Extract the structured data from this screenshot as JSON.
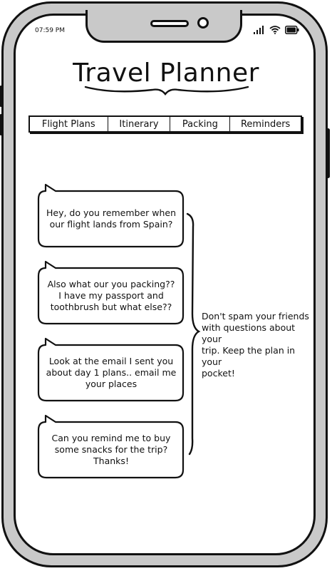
{
  "status_bar": {
    "time": "07:59 PM",
    "icons": [
      "signal-icon",
      "wifi-icon",
      "battery-icon"
    ]
  },
  "header": {
    "title": "Travel Planner"
  },
  "tabs": [
    {
      "label": "Flight Plans"
    },
    {
      "label": "Itinerary"
    },
    {
      "label": "Packing"
    },
    {
      "label": "Reminders"
    }
  ],
  "messages": [
    {
      "lines": [
        "Hey, do you remember when",
        "our flight lands from Spain?"
      ]
    },
    {
      "lines": [
        "Also what our you packing??",
        "I have my passport and",
        "toothbrush but what else??"
      ]
    },
    {
      "lines": [
        "Look at the email I sent you",
        "about day 1 plans.. email me",
        "your places"
      ]
    },
    {
      "lines": [
        "Can you remind me to buy",
        "some snacks for the trip?",
        "Thanks!"
      ]
    }
  ],
  "side_note": {
    "lines": [
      "Don't spam your friends",
      "with questions about your",
      "trip. Keep the plan in your",
      "pocket!"
    ]
  },
  "colors": {
    "frame": "#c9c9c9",
    "ink": "#111111",
    "screen": "#ffffff"
  }
}
